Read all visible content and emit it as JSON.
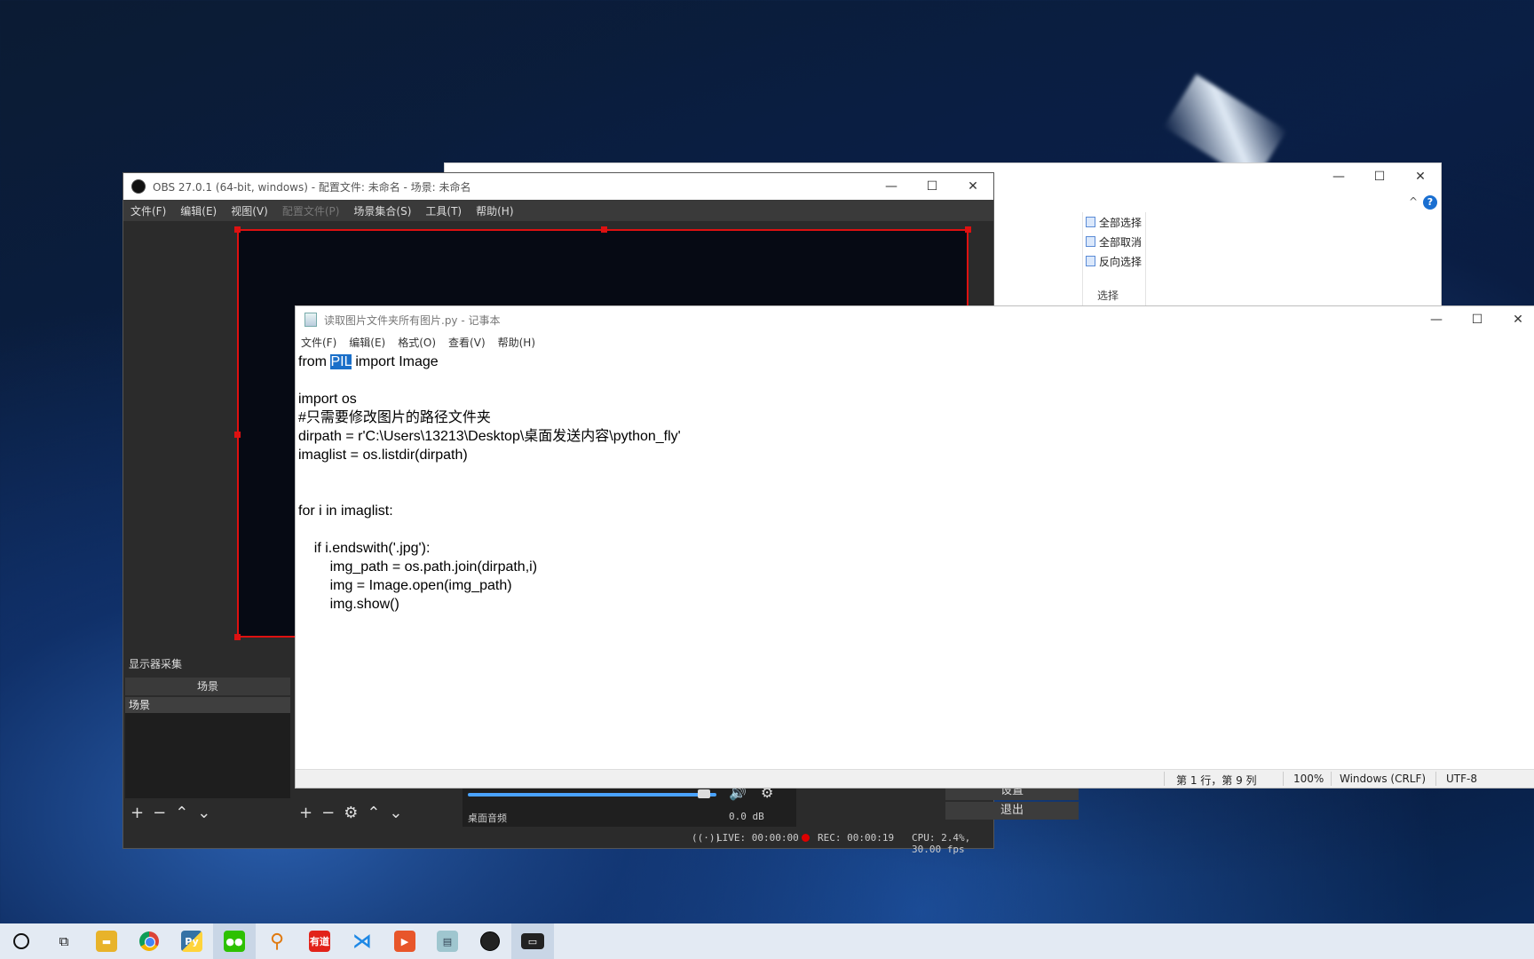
{
  "explorer": {
    "select_all": "全部选择",
    "select_none": "全部取消",
    "invert": "反向选择",
    "group_label": "选择",
    "help_icon": "?",
    "collapse_icon": "^"
  },
  "obs": {
    "title": "OBS 27.0.1 (64-bit, windows) - 配置文件: 未命名 - 场景: 未命名",
    "menu": [
      "文件(F)",
      "编辑(E)",
      "视图(V)",
      "配置文件(P)",
      "场景集合(S)",
      "工具(T)",
      "帮助(H)"
    ],
    "source_label": "显示器采集",
    "scenes_header": "场景",
    "scene_item": "场景",
    "mixer": {
      "track_name": "桌面音频",
      "db_value": "0.0 dB",
      "volume_level": 0.95
    },
    "settings_btn": "设置",
    "exit_btn": "退出",
    "status": {
      "live": "LIVE: 00:00:00",
      "rec": "REC: 00:00:19",
      "cpu": "CPU: 2.4%, 30.00 fps"
    }
  },
  "notepad": {
    "title": "读取图片文件夹所有图片.py - 记事本",
    "menu": [
      "文件(F)",
      "编辑(E)",
      "格式(O)",
      "查看(V)",
      "帮助(H)"
    ],
    "code_first_prefix": "from ",
    "code_first_selected": "PIL",
    "code_first_suffix": " import Image",
    "code_rest": "\n\nimport os\n#只需要修改图片的路径文件夹\ndirpath = r'C:\\Users\\13213\\Desktop\\桌面发送内容\\python_fly'\nimaglist = os.listdir(dirpath)\n\n\nfor i in imaglist:\n\n    if i.endswith('.jpg'):\n        img_path = os.path.join(dirpath,i)\n        img = Image.open(img_path)\n        img.show()",
    "status": {
      "position": "第 1 行，第 9 列",
      "zoom": "100%",
      "line_ending": "Windows (CRLF)",
      "encoding": "UTF-8"
    }
  },
  "window_controls": {
    "minimize": "—",
    "maximize": "☐",
    "close": "✕"
  },
  "taskbar": {
    "icons": [
      "search-icon",
      "task-view-icon",
      "file-explorer-icon",
      "chrome-icon",
      "python-icon",
      "wechat-icon",
      "search-tool-icon",
      "youdao-icon",
      "vscode-icon",
      "foxit-icon",
      "notepad-icon",
      "obs-icon",
      "terminal-icon"
    ],
    "youdao_label": "有道"
  }
}
